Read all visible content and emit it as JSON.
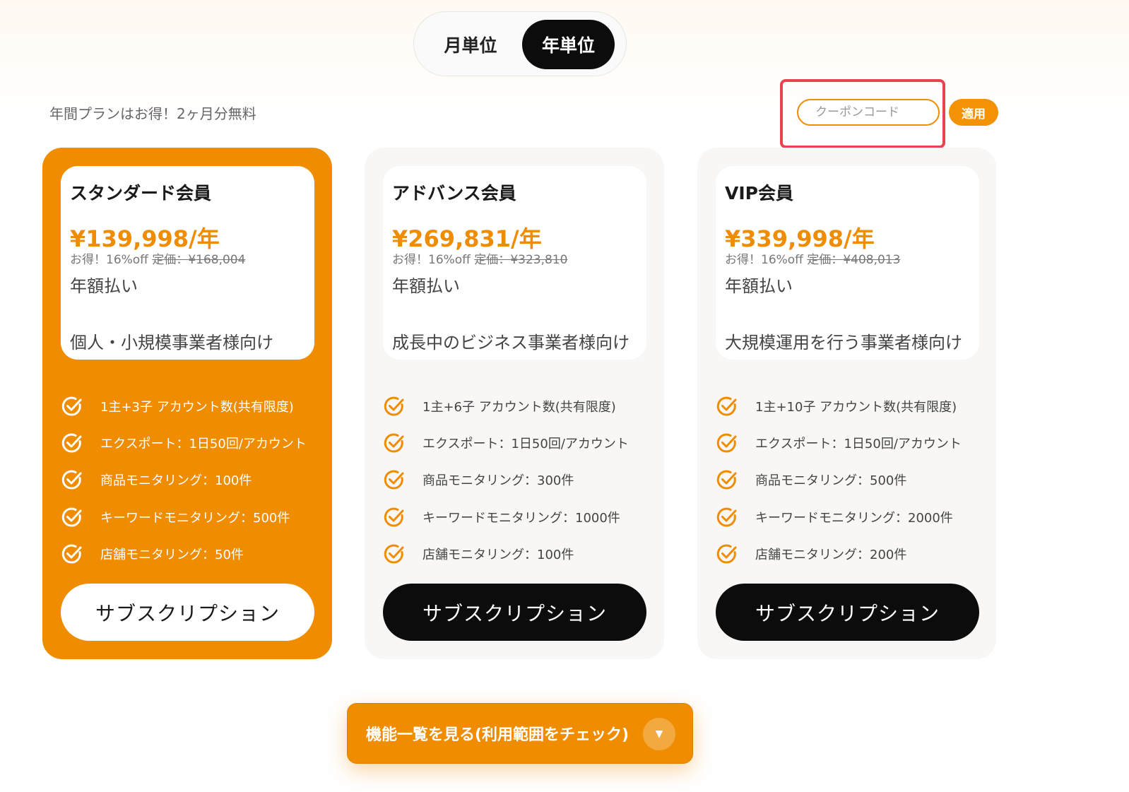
{
  "billing_toggle": {
    "monthly_label": "月単位",
    "yearly_label": "年単位",
    "selected": "yearly"
  },
  "promo_text": "年間プランはお得！2ヶ月分無料",
  "coupon": {
    "placeholder": "クーポンコード",
    "value": "",
    "apply_label": "適用"
  },
  "colors": {
    "accent": "#f08c00",
    "dark": "#0c0c0c",
    "highlight": "#e9434f"
  },
  "plans": [
    {
      "name": "スタンダード会員",
      "price": "¥139,998/年",
      "discount": "お得！16%off",
      "list_price_label": "定価：",
      "list_price": "¥168,004",
      "billing": "年額払い",
      "target": "個人・小規模事業者様向け",
      "featured": true,
      "features": [
        "1主+3子 アカウント数(共有限度)",
        "エクスポート：1日50回/アカウント",
        "商品モニタリング：100件",
        "キーワードモニタリング：500件",
        "店舗モニタリング：50件"
      ],
      "button_label": "サブスクリプション"
    },
    {
      "name": "アドバンス会員",
      "price": "¥269,831/年",
      "discount": "お得！16%off",
      "list_price_label": "定価：",
      "list_price": "¥323,810",
      "billing": "年額払い",
      "target": "成長中のビジネス事業者様向け",
      "featured": false,
      "features": [
        "1主+6子 アカウント数(共有限度)",
        "エクスポート：1日50回/アカウント",
        "商品モニタリング：300件",
        "キーワードモニタリング：1000件",
        "店舗モニタリング：100件"
      ],
      "button_label": "サブスクリプション"
    },
    {
      "name": "VIP会員",
      "price": "¥339,998/年",
      "discount": "お得！16%off",
      "list_price_label": "定価：",
      "list_price": "¥408,013",
      "billing": "年額払い",
      "target": "大規模運用を行う事業者様向け",
      "featured": false,
      "features": [
        "1主+10子 アカウント数(共有限度)",
        "エクスポート：1日50回/アカウント",
        "商品モニタリング：500件",
        "キーワードモニタリング：2000件",
        "店舗モニタリング：200件"
      ],
      "button_label": "サブスクリプション"
    }
  ],
  "features_button": {
    "label": "機能一覧を見る(利用範囲をチェック)",
    "icon": "chevron-down-icon"
  }
}
